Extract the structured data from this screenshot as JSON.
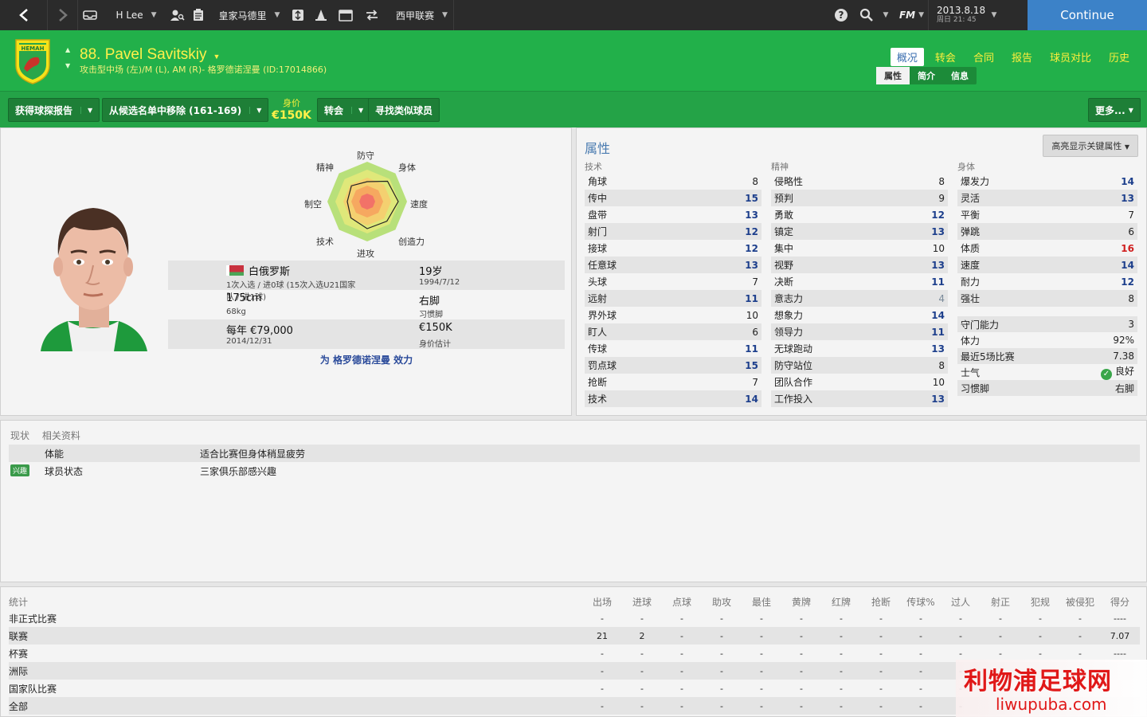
{
  "topbar": {
    "manager": "H Lee",
    "club": "皇家马德里",
    "competition": "西甲联赛",
    "fm": "FM",
    "date": "2013.8.18",
    "time": "周日 21: 45",
    "continue": "Continue"
  },
  "player": {
    "name": "88. Pavel Savitskiy",
    "position": "攻击型中场 (左)/M (L), AM (R)- 格罗德诺涅曼 (ID:17014866)",
    "nationality": "白俄罗斯",
    "caps": "1次入选 / 进0球 (15次入选U21国家队 / 进1球)",
    "age": "19岁",
    "dob": "1994/7/12",
    "height": "175cm",
    "weight": "68kg",
    "foot": "右脚",
    "foot_label": "习惯脚",
    "wage": "每年 €79,000",
    "contract": "2014/12/31",
    "value": "€150K",
    "value_label": "身价估计",
    "plays_for": "为 格罗德诺涅曼 效力"
  },
  "navtabs": [
    "概况",
    "转会",
    "合同",
    "报告",
    "球员对比",
    "历史"
  ],
  "subtabs": [
    "属性",
    "简介",
    "信息"
  ],
  "actions": {
    "scout": "获得球探报告",
    "shortlist": "从候选名单中移除 (161-169)",
    "value_label": "身价",
    "value": "€150K",
    "transfer": "转会",
    "similar": "寻找类似球员",
    "more": "更多..."
  },
  "radar": {
    "labels": [
      "防守",
      "身体",
      "速度",
      "创造力",
      "进攻",
      "技术",
      "制空",
      "精神"
    ],
    "values": [
      0.5,
      0.72,
      0.78,
      0.7,
      0.68,
      0.58,
      0.5,
      0.56
    ]
  },
  "attributes": {
    "title": "属性",
    "highlight": "高亮显示关键属性",
    "technical_head": "技术",
    "mental_head": "精神",
    "physical_head": "身体",
    "technical": [
      {
        "k": "角球",
        "v": "8"
      },
      {
        "k": "传中",
        "v": "15"
      },
      {
        "k": "盘带",
        "v": "13"
      },
      {
        "k": "射门",
        "v": "12"
      },
      {
        "k": "接球",
        "v": "12"
      },
      {
        "k": "任意球",
        "v": "13"
      },
      {
        "k": "头球",
        "v": "7"
      },
      {
        "k": "远射",
        "v": "11"
      },
      {
        "k": "界外球",
        "v": "10"
      },
      {
        "k": "盯人",
        "v": "6"
      },
      {
        "k": "传球",
        "v": "11"
      },
      {
        "k": "罚点球",
        "v": "15"
      },
      {
        "k": "抢断",
        "v": "7"
      },
      {
        "k": "技术",
        "v": "14"
      }
    ],
    "mental": [
      {
        "k": "侵略性",
        "v": "8"
      },
      {
        "k": "预判",
        "v": "9"
      },
      {
        "k": "勇敢",
        "v": "12"
      },
      {
        "k": "镇定",
        "v": "13"
      },
      {
        "k": "集中",
        "v": "10"
      },
      {
        "k": "视野",
        "v": "13"
      },
      {
        "k": "决断",
        "v": "11"
      },
      {
        "k": "意志力",
        "v": "4"
      },
      {
        "k": "想象力",
        "v": "14"
      },
      {
        "k": "领导力",
        "v": "11"
      },
      {
        "k": "无球跑动",
        "v": "13"
      },
      {
        "k": "防守站位",
        "v": "8"
      },
      {
        "k": "团队合作",
        "v": "10"
      },
      {
        "k": "工作投入",
        "v": "13"
      }
    ],
    "physical": [
      {
        "k": "爆发力",
        "v": "14"
      },
      {
        "k": "灵活",
        "v": "13"
      },
      {
        "k": "平衡",
        "v": "7"
      },
      {
        "k": "弹跳",
        "v": "6"
      },
      {
        "k": "体质",
        "v": "16"
      },
      {
        "k": "速度",
        "v": "14"
      },
      {
        "k": "耐力",
        "v": "12"
      },
      {
        "k": "强壮",
        "v": "8"
      }
    ],
    "extra": [
      {
        "k": "守门能力",
        "v": "3"
      },
      {
        "k": "体力",
        "v": "92%"
      },
      {
        "k": "最近5场比赛",
        "v": "7.38"
      },
      {
        "k": "士气",
        "v": "良好"
      },
      {
        "k": "习惯脚",
        "v": "右脚"
      }
    ]
  },
  "status": {
    "tab1": "现状",
    "tab2": "相关资料",
    "badge": "兴趣",
    "rows": [
      {
        "k": "体能",
        "v": "适合比赛但身体稍显疲劳"
      },
      {
        "k": "球员状态",
        "v": "三家俱乐部感兴趣"
      }
    ]
  },
  "stats": {
    "head": "统计",
    "columns": [
      "出场",
      "进球",
      "点球",
      "助攻",
      "最佳",
      "黄牌",
      "红牌",
      "抢断",
      "传球%",
      "过人",
      "射正",
      "犯规",
      "被侵犯",
      "得分"
    ],
    "rows": [
      {
        "name": "非正式比赛",
        "vals": [
          "-",
          "-",
          "-",
          "-",
          "-",
          "-",
          "-",
          "-",
          "-",
          "-",
          "-",
          "-",
          "-",
          "----"
        ]
      },
      {
        "name": "联赛",
        "vals": [
          "21",
          "2",
          "-",
          "-",
          "-",
          "-",
          "-",
          "-",
          "-",
          "-",
          "-",
          "-",
          "-",
          "7.07"
        ]
      },
      {
        "name": "杯赛",
        "vals": [
          "-",
          "-",
          "-",
          "-",
          "-",
          "-",
          "-",
          "-",
          "-",
          "-",
          "-",
          "-",
          "-",
          "----"
        ]
      },
      {
        "name": "洲际",
        "vals": [
          "-",
          "-",
          "-",
          "-",
          "-",
          "-",
          "-",
          "-",
          "-",
          "-",
          "-",
          "-",
          "-",
          ""
        ]
      },
      {
        "name": "国家队比赛",
        "vals": [
          "-",
          "-",
          "-",
          "-",
          "-",
          "-",
          "-",
          "-",
          "-",
          "-",
          "-",
          "-",
          "-",
          ""
        ]
      },
      {
        "name": "全部",
        "vals": [
          "-",
          "-",
          "-",
          "-",
          "-",
          "-",
          "-",
          "-",
          "-",
          "-",
          "-",
          "-",
          "-",
          ""
        ]
      }
    ]
  },
  "watermark": {
    "cn": "利物浦足球网",
    "en": "liwupuba.com"
  },
  "colors": {
    "accent": "#22b04a",
    "continue": "#3c82c8",
    "value_blue": "#1d3f8c",
    "warn": "#d02020"
  }
}
